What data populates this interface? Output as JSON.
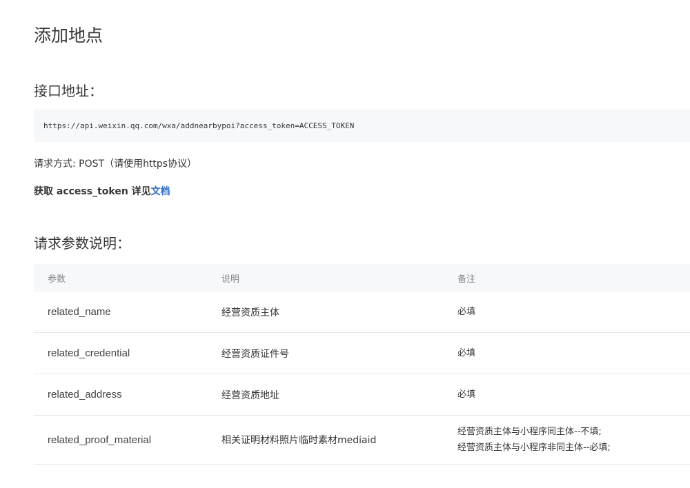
{
  "page": {
    "title": "添加地点"
  },
  "api": {
    "heading": "接口地址：",
    "url": "https://api.weixin.qq.com/wxa/addnearbypoi?access_token=ACCESS_TOKEN",
    "method_text": "请求方式: POST（请使用https协议）",
    "token_prefix": "获取 access_token 详见",
    "token_link": "文档"
  },
  "params": {
    "heading": "请求参数说明：",
    "columns": [
      "参数",
      "说明",
      "备注"
    ],
    "rows": [
      {
        "name": "related_name",
        "desc": "经营资质主体",
        "remark": [
          "必填"
        ]
      },
      {
        "name": "related_credential",
        "desc": "经营资质证件号",
        "remark": [
          "必填"
        ]
      },
      {
        "name": "related_address",
        "desc": "经营资质地址",
        "remark": [
          "必填"
        ]
      },
      {
        "name": "related_proof_material",
        "desc": "相关证明材料照片临时素材mediaid",
        "remark": [
          "经营资质主体与小程序同主体--不填;",
          "经营资质主体与小程序非同主体--必填;"
        ]
      }
    ]
  },
  "colors": {
    "text": "#353535",
    "link": "#2a6cc8",
    "code_bg": "#f6f8fa",
    "header_text": "#888888",
    "divider": "#e7e7eb"
  }
}
